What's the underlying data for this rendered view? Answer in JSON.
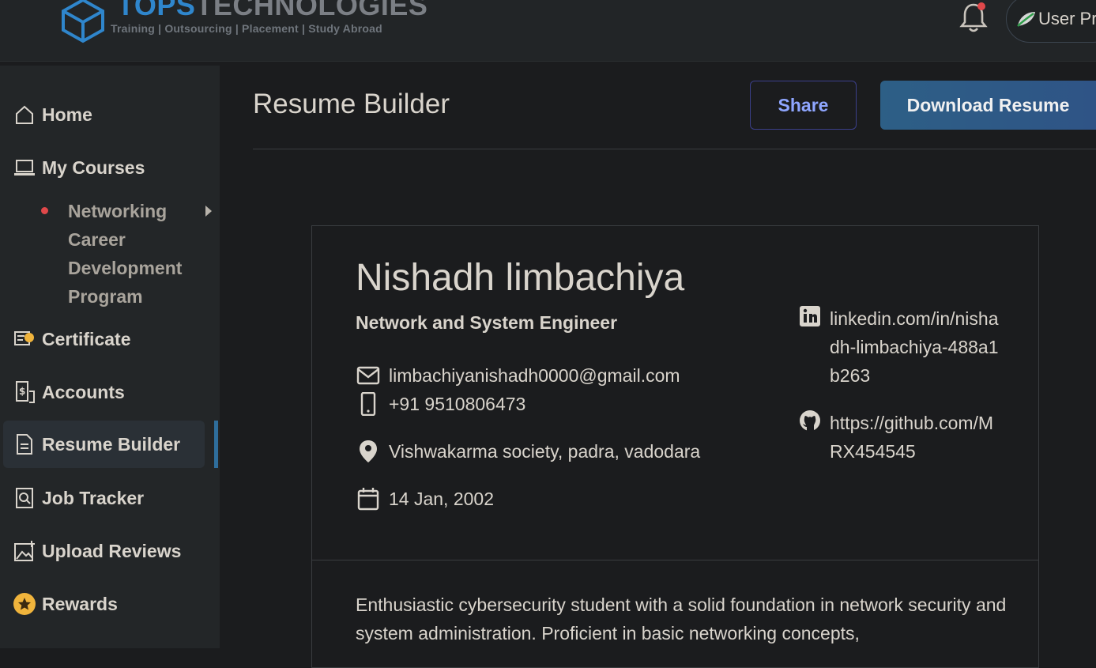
{
  "header": {
    "logo_word_1": "TOPS",
    "logo_word_2": "TECHNOLOGIES",
    "logo_tagline": "Training  |   Outsourcing  |  Placement  |  Study Abroad",
    "user_label": "User Pr"
  },
  "sidebar": {
    "items": [
      {
        "label": "Home",
        "icon": "home-icon"
      },
      {
        "label": "My Courses",
        "icon": "laptop-icon"
      },
      {
        "label": "Certificate",
        "icon": "certificate-icon"
      },
      {
        "label": "Accounts",
        "icon": "accounts-icon"
      },
      {
        "label": "Resume Builder",
        "icon": "document-icon"
      },
      {
        "label": "Job Tracker",
        "icon": "job-tracker-icon"
      },
      {
        "label": "Upload Reviews",
        "icon": "image-upload-icon"
      },
      {
        "label": "Rewards",
        "icon": "star-icon"
      }
    ],
    "active": "Resume Builder",
    "sub_item": "Networking Career Development Program"
  },
  "main": {
    "title": "Resume Builder",
    "share_label": "Share",
    "download_label": "Download Resume"
  },
  "resume": {
    "name": "Nishadh limbachiya",
    "role": "Network and System Engineer",
    "email": "limbachiyanishadh0000@gmail.com",
    "phone": "+91 9510806473",
    "address": "Vishwakarma society, padra, vadodara",
    "dob": "14 Jan, 2002",
    "linkedin": "linkedin.com/in/nishadh-limbachiya-488a1b263",
    "github": "https://github.com/MRX454545",
    "summary": "Enthusiastic cybersecurity student with a solid foundation in network security and system administration. Proficient in basic networking concepts,"
  },
  "colors": {
    "accent": "#2f86cc",
    "download_button": "#2d5f86",
    "notification_dot": "#e0484a",
    "rewards_badge": "#f0b43c"
  }
}
